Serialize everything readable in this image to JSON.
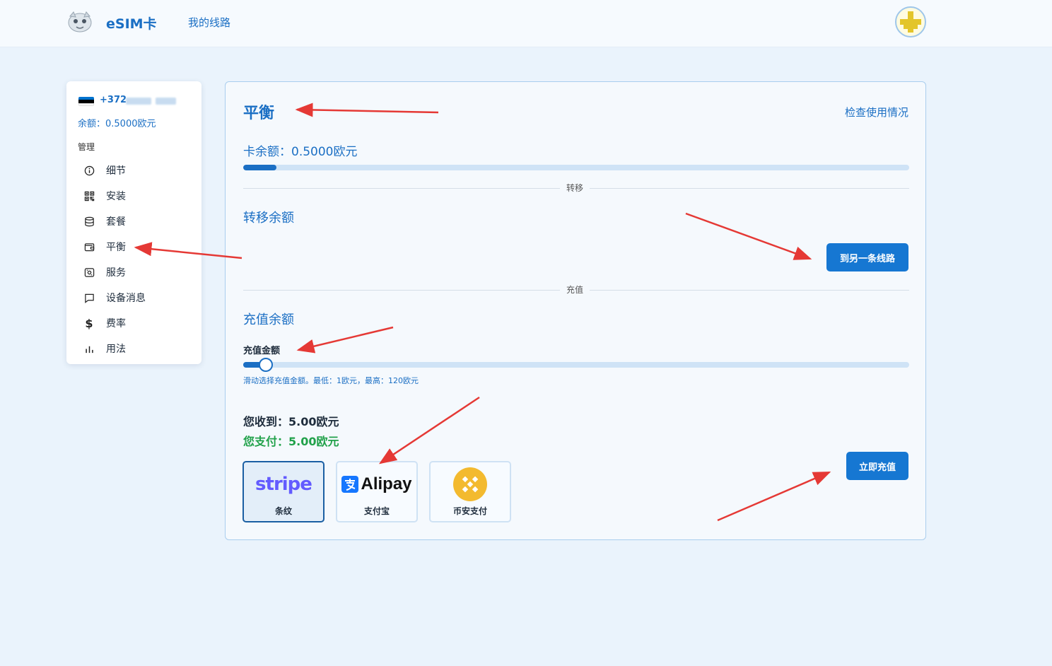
{
  "header": {
    "brand": "eSIM卡",
    "nav_link": "我的线路"
  },
  "sidebar": {
    "phone_prefix": "+372",
    "balance": "余额：0.5000欧元",
    "section_title": "管理",
    "items": [
      {
        "label": "细节",
        "icon": "info-icon"
      },
      {
        "label": "安装",
        "icon": "qr-code-icon"
      },
      {
        "label": "套餐",
        "icon": "database-icon"
      },
      {
        "label": "平衡",
        "icon": "wallet-icon"
      },
      {
        "label": "服务",
        "icon": "services-icon"
      },
      {
        "label": "设备消息",
        "icon": "message-icon"
      },
      {
        "label": "费率",
        "icon": "dollar-icon"
      },
      {
        "label": "用法",
        "icon": "bar-chart-icon"
      }
    ]
  },
  "main": {
    "title": "平衡",
    "check_usage": "检查使用情况",
    "card_balance": "卡余额：0.5000欧元",
    "balance_progress": 0.05,
    "transfer": {
      "divider": "转移",
      "title": "转移余额",
      "button": "到另一条线路"
    },
    "recharge": {
      "divider": "充值",
      "title": "充值余额",
      "amount_label": "充值金额",
      "slider_value": 5,
      "slider_min": 1,
      "slider_max": 120,
      "hint": "滑动选择充值金额。最低：1欧元，最高：120欧元",
      "receive": "您收到：5.00欧元",
      "pay": "您支付：5.00欧元",
      "button": "立即充值",
      "payment_options": [
        {
          "logo_text": "stripe",
          "label": "条纹",
          "selected": true
        },
        {
          "logo_text": "Alipay",
          "label": "支付宝",
          "selected": false
        },
        {
          "label": "币安支付",
          "selected": false
        }
      ]
    }
  },
  "colors": {
    "accent": "#1b6fc4",
    "button": "#1677d2",
    "pay_green": "#21a14a",
    "background": "#eaf3fc",
    "annotation_arrow": "#e53935"
  }
}
